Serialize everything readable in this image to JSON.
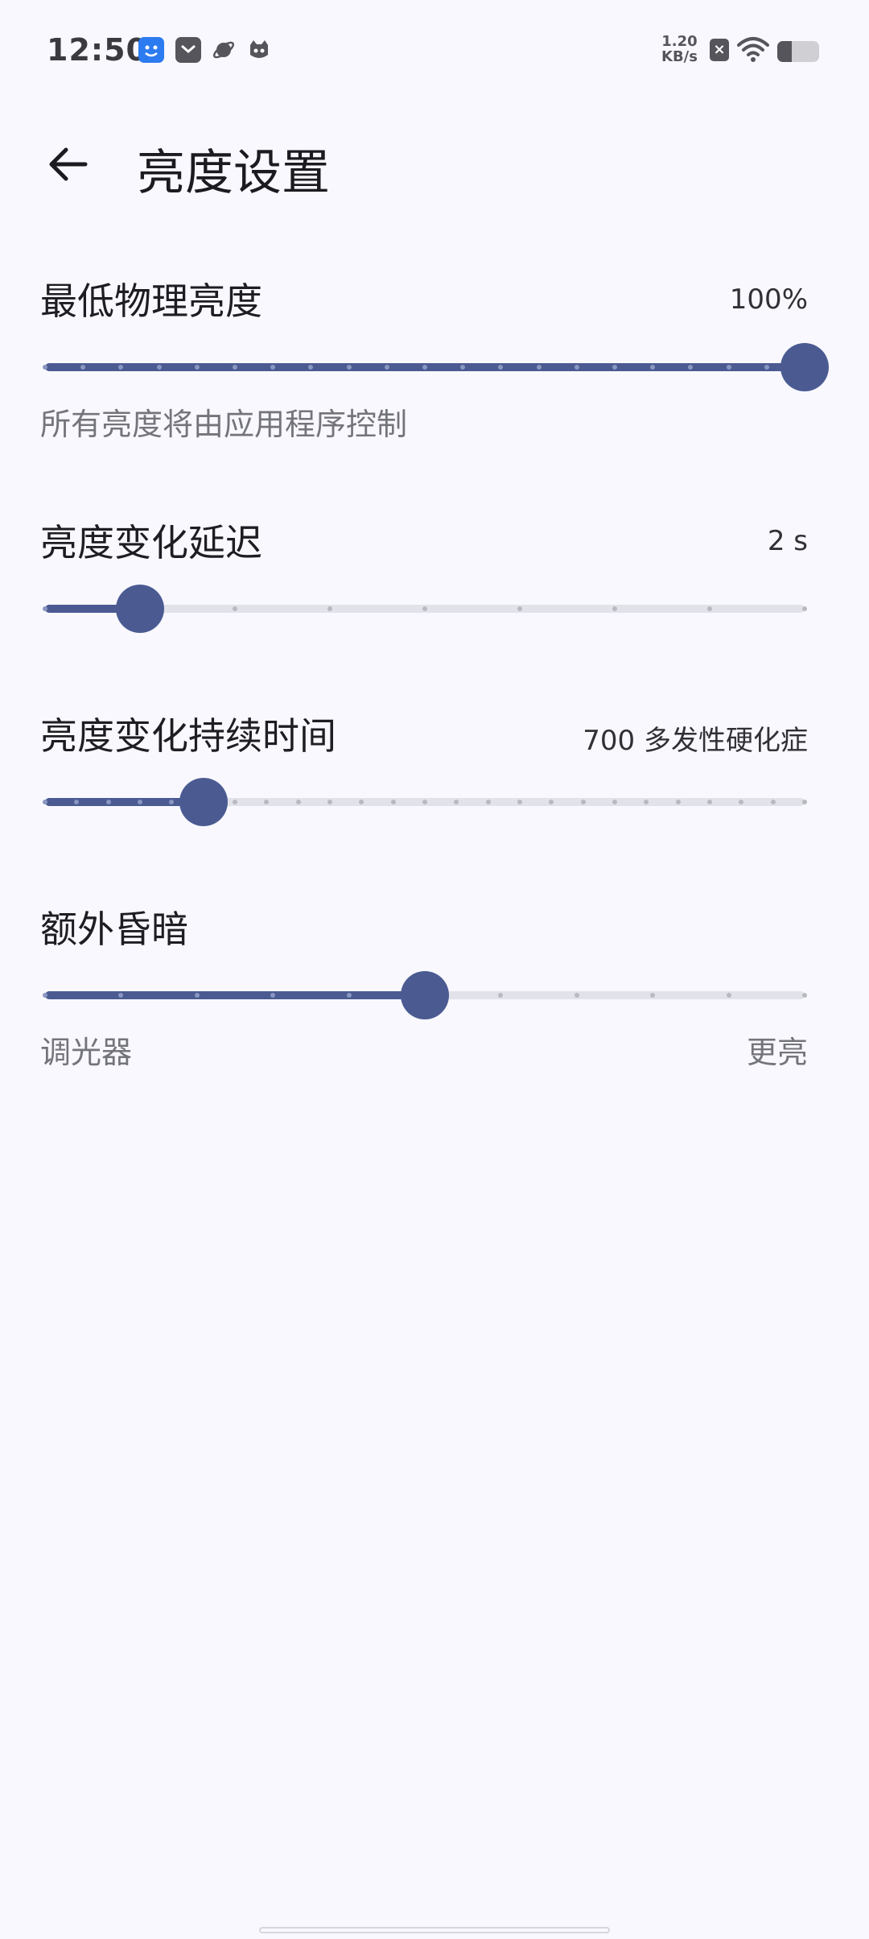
{
  "status_bar": {
    "time": "12:50",
    "net_speed_value": "1.20",
    "net_speed_unit": "KB/s",
    "battery_level": 0.35,
    "notification_icons": [
      "blue-app-icon",
      "mail-icon",
      "planet-icon",
      "cat-icon"
    ]
  },
  "header": {
    "title": "亮度设置",
    "back_icon": "arrow-left-icon"
  },
  "settings": [
    {
      "label": "最低物理亮度",
      "value": "100%",
      "subtitle": "所有亮度将由应用程序控制",
      "slider": {
        "steps": 20,
        "position": 20
      }
    },
    {
      "label": "亮度变化延迟",
      "value": "2 s",
      "slider": {
        "steps": 8,
        "position": 1
      }
    },
    {
      "label": "亮度变化持续时间",
      "value": "700 多发性硬化症",
      "slider": {
        "steps": 24,
        "position": 5
      }
    },
    {
      "label": "额外昏暗",
      "min_label": "调光器",
      "max_label": "更亮",
      "slider": {
        "steps": 10,
        "position": 5
      }
    }
  ],
  "colors": {
    "accent": "#4b5b92",
    "track_inactive": "#e2e2ea",
    "background": "#f8f8fe"
  }
}
